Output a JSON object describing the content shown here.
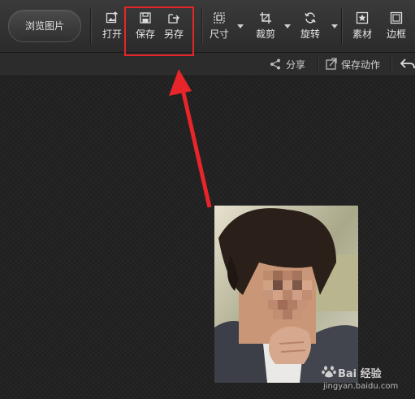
{
  "toolbar": {
    "browse_label": "浏览图片",
    "tools": [
      {
        "label": "打开",
        "icon": "open-image-icon"
      },
      {
        "label": "保存",
        "icon": "save-icon"
      },
      {
        "label": "另存",
        "icon": "save-as-icon"
      },
      {
        "label": "尺寸",
        "icon": "resize-icon"
      },
      {
        "label": "裁剪",
        "icon": "crop-icon"
      },
      {
        "label": "旋转",
        "icon": "rotate-icon"
      },
      {
        "label": "素材",
        "icon": "material-icon"
      },
      {
        "label": "边框",
        "icon": "border-icon"
      }
    ]
  },
  "subbar": {
    "share_label": "分享",
    "save_action_label": "保存动作"
  },
  "watermark": {
    "logo_text": "Bai 经验",
    "url": "jingyan.baidu.com"
  },
  "colors": {
    "highlight": "#e8252a",
    "arrow": "#e8252a",
    "background": "#232323"
  }
}
